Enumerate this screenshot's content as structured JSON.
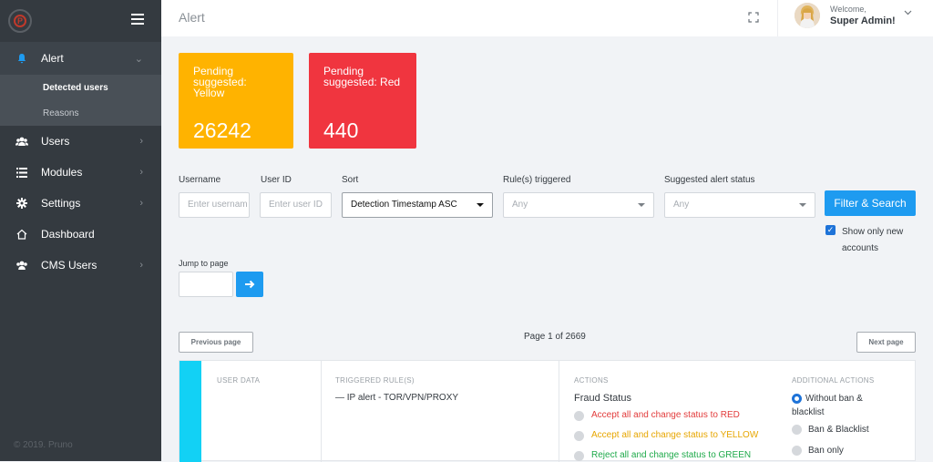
{
  "sidebar": {
    "items": [
      {
        "label": "Alert"
      },
      {
        "label": "Users"
      },
      {
        "label": "Modules"
      },
      {
        "label": "Settings"
      },
      {
        "label": "Dashboard"
      },
      {
        "label": "CMS Users"
      }
    ],
    "sub_items": [
      {
        "label": "Detected users"
      },
      {
        "label": "Reasons"
      }
    ],
    "copyright": "© 2019. Pruno"
  },
  "header": {
    "title": "Alert",
    "welcome": "Welcome,",
    "username": "Super Admin!"
  },
  "cards": {
    "yellow": {
      "title": "Pending suggested: Yellow",
      "value": "26242",
      "color": "#ffb300"
    },
    "red": {
      "title": "Pending suggested: Red",
      "value": "440",
      "color": "#f0353f"
    }
  },
  "filters": {
    "username_label": "Username",
    "username_placeholder": "Enter usernam",
    "userid_label": "User ID",
    "userid_placeholder": "Enter user ID",
    "sort_label": "Sort",
    "sort_value": "Detection Timestamp ASC",
    "rules_label": "Rule(s) triggered",
    "rules_value": "Any",
    "status_label": "Suggested alert status",
    "status_value": "Any",
    "search_button": "Filter & Search",
    "new_accounts_label": "Show only new accounts",
    "jump_label": "Jump to page"
  },
  "pagination": {
    "prev": "Previous page",
    "next": "Next page",
    "info": "Page 1 of 2669"
  },
  "alert_row": {
    "user_data_head": "USER DATA",
    "rules_head": "TRIGGERED RULE(S)",
    "rule_text": "— IP alert - TOR/VPN/PROXY",
    "actions_head": "ACTIONS",
    "fraud_status": "Fraud Status",
    "action_red": "Accept all and change status to RED",
    "action_yellow": "Accept all and change status to YELLOW",
    "action_green": "Reject all and change status to GREEN",
    "additional_head": "ADDITIONAL ACTIONS",
    "addl_1": "Without ban & blacklist",
    "addl_2": "Ban & Blacklist",
    "addl_3": "Ban only"
  },
  "colors": {
    "accent": "#1e9bf0",
    "sidebar": "#343a40",
    "stripe": "#12d1f5"
  }
}
